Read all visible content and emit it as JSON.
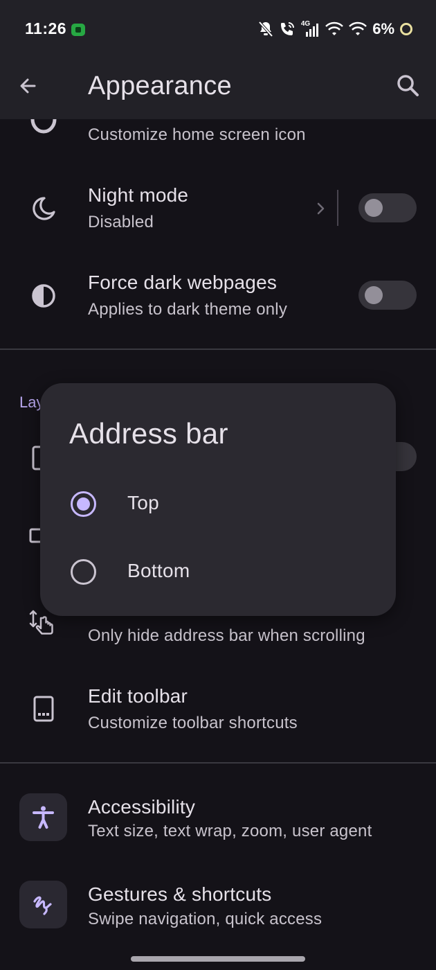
{
  "status_bar": {
    "time": "11:26",
    "network": "4G",
    "battery": "6%"
  },
  "app_bar": {
    "title": "Appearance",
    "back_icon": "arrow-back-icon",
    "search_icon": "search-icon"
  },
  "settings": {
    "app_icon": {
      "subtitle": "Customize home screen icon",
      "icon": "app-icon-shape-icon"
    },
    "night_mode": {
      "title": "Night mode",
      "subtitle": "Disabled",
      "enabled": false,
      "icon": "moon-icon"
    },
    "force_dark": {
      "title": "Force dark webpages",
      "subtitle": "Applies to dark theme only",
      "enabled": false,
      "icon": "contrast-icon"
    },
    "layout_section": {
      "header": "Lay"
    },
    "hide_address_bar": {
      "subtitle": "Only hide address bar when scrolling",
      "icon": "swipe-vertical-icon"
    },
    "edit_toolbar": {
      "title": "Edit toolbar",
      "subtitle": "Customize toolbar shortcuts",
      "icon": "toolbar-icon"
    },
    "accessibility": {
      "title": "Accessibility",
      "subtitle": "Text size, text wrap, zoom, user agent",
      "icon": "accessibility-icon"
    },
    "gestures": {
      "title": "Gestures & shortcuts",
      "subtitle": "Swipe navigation, quick access",
      "icon": "gesture-icon"
    }
  },
  "dialog": {
    "title": "Address bar",
    "options": [
      {
        "label": "Top",
        "selected": true
      },
      {
        "label": "Bottom",
        "selected": false
      }
    ]
  },
  "colors": {
    "background": "#141218",
    "surface": "#222127",
    "dialog": "#2b2930",
    "accent": "#c7b8ff",
    "accent_section": "#b9a8f0"
  }
}
